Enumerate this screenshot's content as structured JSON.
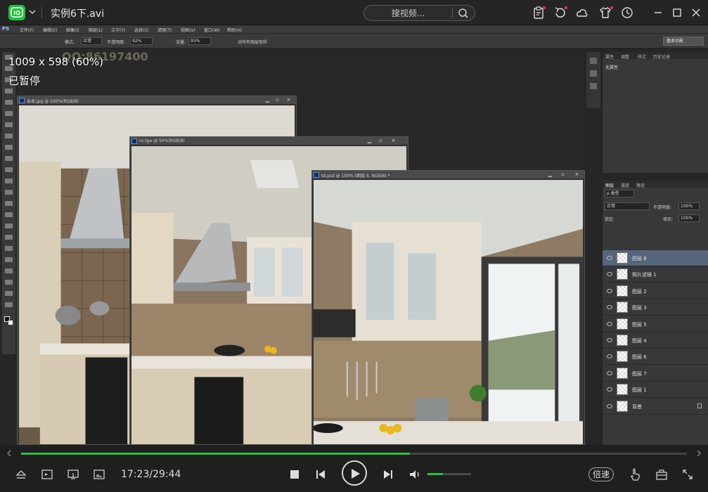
{
  "player": {
    "file_title": "实例6下.avi",
    "search_placeholder": "搜视频...",
    "overlay_resolution": "1009 x 598 (60%)",
    "overlay_status": "已暂停",
    "watermark": "QQ:86197400",
    "time_display": "17:23/29:44",
    "progress": 0.584,
    "volume": 0.35,
    "speed_label": "倍速",
    "colors": {
      "accent": "#2dc23a",
      "logo": "#1fc23c"
    }
  },
  "photoshop": {
    "app_abbrev": "PS",
    "menus": [
      "文件(F)",
      "编辑(E)",
      "图像(I)",
      "图层(L)",
      "文字(Y)",
      "选择(S)",
      "滤镜(T)",
      "视图(V)",
      "窗口(W)",
      "帮助(H)"
    ],
    "options": {
      "mode_label": "模式:",
      "mode_value": "正常",
      "opacity_label": "不透明度:",
      "opacity_value": "92%",
      "flow_label": "流量:",
      "flow_value": "95%",
      "sample_label": "对所有图层取样",
      "workspace": "基本功能"
    },
    "documents": [
      {
        "title": "亲本.jpg @ 100%(RGB/8)"
      },
      {
        "title": "cs.tga @ 50%(RGB/8)"
      },
      {
        "title": "td.psd @ 100% (图层 8, RGB/8) *"
      }
    ],
    "panel_top": {
      "tabs": [
        "属性",
        "调整",
        "样式",
        "历史记录"
      ],
      "content": "无属性"
    },
    "layers_panel": {
      "tabs": [
        "图层",
        "通道",
        "路径"
      ],
      "kind_label": "p 类型",
      "blend_mode": "正常",
      "opacity_label": "不透明度:",
      "opacity_value": "100%",
      "lock_label": "锁定:",
      "fill_label": "填充:",
      "fill_value": "100%",
      "layers": [
        {
          "name": "图层 8",
          "active": true
        },
        {
          "name": "照片滤镜 1",
          "active": false
        },
        {
          "name": "图层 2",
          "active": false
        },
        {
          "name": "图层 3",
          "active": false
        },
        {
          "name": "图层 5",
          "active": false
        },
        {
          "name": "图层 4",
          "active": false
        },
        {
          "name": "图层 6",
          "active": false
        },
        {
          "name": "图层 7",
          "active": false
        },
        {
          "name": "图层 1",
          "active": false
        },
        {
          "name": "背景",
          "active": false
        }
      ]
    }
  }
}
